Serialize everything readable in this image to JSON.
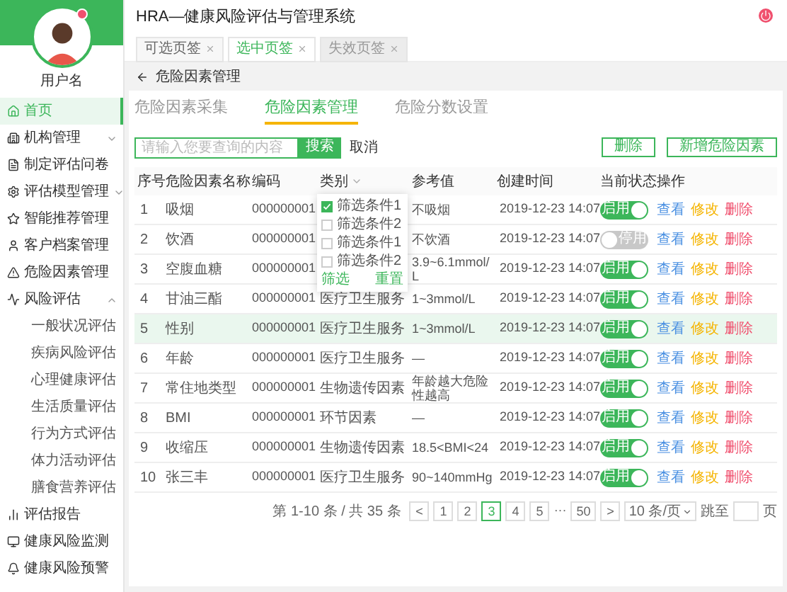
{
  "app_title": "HRA—健康风险评估与管理系统",
  "user": {
    "name": "用户名"
  },
  "page_tabs": [
    {
      "label": "可选页签",
      "selected": false,
      "disabled": false
    },
    {
      "label": "选中页签",
      "selected": true,
      "disabled": false
    },
    {
      "label": "失效页签",
      "selected": false,
      "disabled": true
    }
  ],
  "sidebar": {
    "items": [
      {
        "label": "首页",
        "selected": true
      },
      {
        "label": "机构管理",
        "selected": false,
        "expanded": false
      },
      {
        "label": "制定评估问卷",
        "selected": false
      },
      {
        "label": "评估模型管理",
        "selected": false,
        "expanded": false
      },
      {
        "label": "智能推荐管理",
        "selected": false
      },
      {
        "label": "客户档案管理",
        "selected": false
      },
      {
        "label": "危险因素管理",
        "selected": false
      },
      {
        "label": "风险评估",
        "selected": false,
        "expanded": true,
        "children": [
          {
            "label": "一般状况评估"
          },
          {
            "label": "疾病风险评估"
          },
          {
            "label": "心理健康评估"
          },
          {
            "label": "生活质量评估"
          },
          {
            "label": "行为方式评估"
          },
          {
            "label": "体力活动评估"
          },
          {
            "label": "膳食营养评估"
          }
        ]
      },
      {
        "label": "评估报告",
        "selected": false
      },
      {
        "label": "健康风险监测",
        "selected": false
      },
      {
        "label": "健康风险预警",
        "selected": false
      }
    ]
  },
  "breadcrumb": "危险因素管理",
  "sub_tabs": [
    {
      "label": "危险因素采集",
      "selected": false
    },
    {
      "label": "危险因素管理",
      "selected": true
    },
    {
      "label": "危险分数设置",
      "selected": false
    }
  ],
  "search": {
    "placeholder": "请输入您要查询的内容",
    "button": "搜索",
    "cancel": "取消"
  },
  "actions": [
    "删除",
    "新增危险因素"
  ],
  "table": {
    "columns": [
      "序号",
      "危险因素名称",
      "编码",
      "类别",
      "参考值",
      "创建时间",
      "当前状态",
      "操作"
    ],
    "rows": [
      {
        "no": "1",
        "name": "吸烟",
        "code": "000000001",
        "reference": "不吸烟",
        "created": "2019-12-23 14:07",
        "on": true,
        "status": "启用",
        "selected": false
      },
      {
        "no": "2",
        "name": "饮酒",
        "code": "000000001",
        "reference": "不饮酒",
        "created": "2019-12-23 14:07",
        "on": false,
        "status": "停用",
        "selected": false
      },
      {
        "no": "3",
        "name": "空腹血糖",
        "code": "000000001",
        "reference": "3.9~6.1mmol/L",
        "created": "2019-12-23 14:07",
        "on": true,
        "status": "启用",
        "selected": false
      },
      {
        "no": "4",
        "name": "甘油三酯",
        "code": "000000001",
        "category": "医疗卫生服务",
        "reference": "1~3mmol/L",
        "created": "2019-12-23 14:07",
        "on": true,
        "status": "启用",
        "selected": false
      },
      {
        "no": "5",
        "name": "性别",
        "code": "000000001",
        "category": "医疗卫生服务",
        "reference": "1~3mmol/L",
        "created": "2019-12-23 14:07",
        "on": true,
        "status": "启用",
        "selected": true
      },
      {
        "no": "6",
        "name": "年龄",
        "code": "000000001",
        "category": "医疗卫生服务",
        "reference": "—",
        "created": "2019-12-23 14:07",
        "on": true,
        "status": "启用",
        "selected": false
      },
      {
        "no": "7",
        "name": "常住地类型",
        "code": "000000001",
        "category": "生物遗传因素",
        "reference": "年龄越大危险性越高",
        "created": "2019-12-23 14:07",
        "on": true,
        "status": "启用",
        "selected": false
      },
      {
        "no": "8",
        "name": "BMI",
        "code": "000000001",
        "category": "环节因素",
        "reference": "—",
        "created": "2019-12-23 14:07",
        "on": true,
        "status": "启用",
        "selected": false
      },
      {
        "no": "9",
        "name": "收缩压",
        "code": "000000001",
        "category": "生物遗传因素",
        "reference": "18.5<BMI<24",
        "created": "2019-12-23 14:07",
        "on": true,
        "status": "启用",
        "selected": false
      },
      {
        "no": "10",
        "name": "张三丰",
        "code": "000000001",
        "category": "医疗卫生服务",
        "reference": "90~140mmHg",
        "created": "2019-12-23 14:07",
        "on": true,
        "status": "启用",
        "selected": false
      }
    ],
    "actions": [
      [
        "查看",
        "修改",
        "删除"
      ],
      [
        "查看",
        "修改",
        "删除"
      ],
      [
        "查看",
        "修改",
        "删除"
      ],
      [
        "查看",
        "修改",
        "删除"
      ],
      [
        "查看",
        "修改",
        "删除"
      ],
      [
        "查看",
        "修改",
        "删除"
      ],
      [
        "查看",
        "修改",
        "删除"
      ],
      [
        "查看",
        "修改",
        "删除"
      ],
      [
        "查看",
        "修改",
        "删除"
      ],
      [
        "查看",
        "修改",
        "删除"
      ]
    ]
  },
  "filter_dropdown": {
    "options": [
      {
        "label": "筛选条件1",
        "checked": true
      },
      {
        "label": "筛选条件2",
        "checked": false
      },
      {
        "label": "筛选条件1",
        "checked": false
      },
      {
        "label": "筛选条件2",
        "checked": false
      }
    ],
    "confirm": "筛选",
    "reset": "重置"
  },
  "pagination": {
    "summary": "第 1-10 条 / 共 35 条",
    "prev": "<",
    "pages": [
      {
        "label": "1",
        "selected": false
      },
      {
        "label": "2",
        "selected": false
      },
      {
        "label": "3",
        "selected": true
      },
      {
        "label": "4",
        "selected": false
      },
      {
        "label": "5",
        "selected": false
      }
    ],
    "ellipsis": "···",
    "last": "50",
    "next": ">",
    "page_size": "10 条/页",
    "jump_label": "跳至",
    "jump_suffix": "页"
  }
}
